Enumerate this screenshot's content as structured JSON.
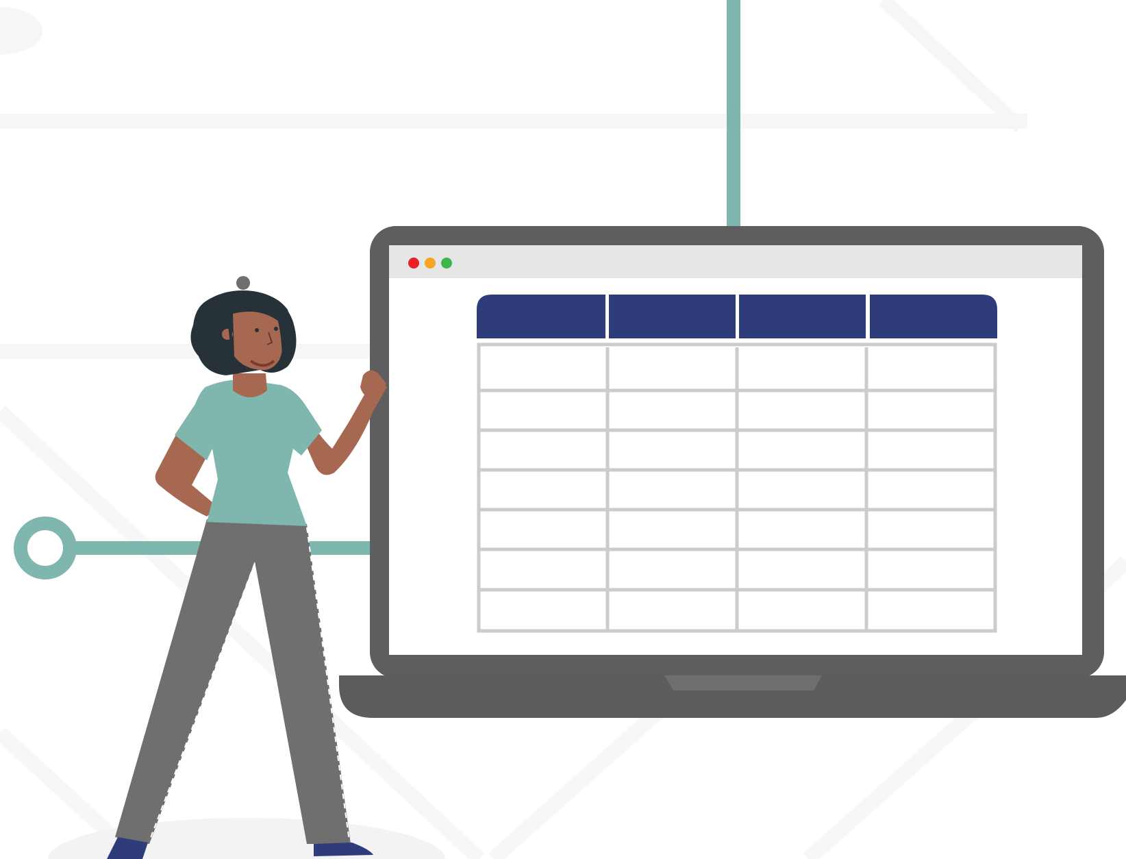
{
  "colors": {
    "background": "#ffffff",
    "background_line": "#f4f6f7",
    "teal": "#7fb6ad",
    "laptop_body": "#5e5e5e",
    "laptop_base": "#5c5c5c",
    "laptop_notch": "#6e6e6e",
    "screen": "#ffffff",
    "browser_bar": "#e6e6e6",
    "traffic_red": "#e8202a",
    "traffic_yellow": "#f5a623",
    "traffic_green": "#3db74a",
    "table_header": "#2e3d7a",
    "table_grid": "#cccccc",
    "skin": "#a76852",
    "hair": "#263238",
    "shirt": "#7fb6ad",
    "pants": "#6f6f6f",
    "shoes": "#2e3d7a",
    "floor_shadow": "#f3f3f3"
  },
  "icons": [
    "close-dot",
    "minimize-dot",
    "maximize-dot"
  ],
  "table": {
    "header_columns": 4,
    "body_rows": 7,
    "body_columns": 4
  }
}
